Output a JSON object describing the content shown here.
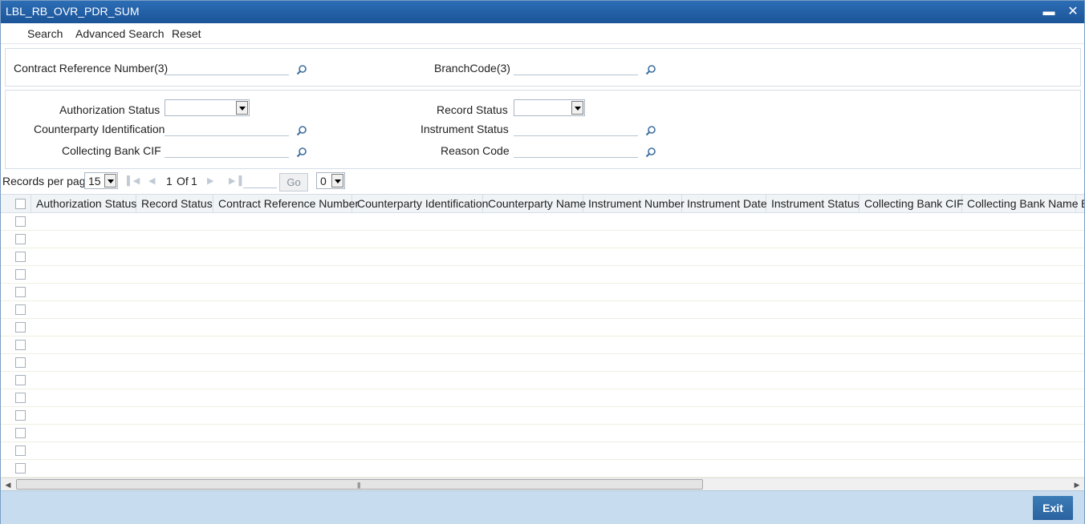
{
  "window": {
    "title": "LBL_RB_OVR_PDR_SUM",
    "minimize_icon": "minimize-icon",
    "close_icon": "close-icon"
  },
  "menu": {
    "search": "Search",
    "advanced_search": "Advanced Search",
    "reset": "Reset"
  },
  "search_panel": {
    "contract_ref_label": "Contract Reference Number(3)",
    "contract_ref_value": "",
    "branch_code_label": "BranchCode(3)",
    "branch_code_value": ""
  },
  "filters": {
    "authorization_status_label": "Authorization Status",
    "authorization_status_value": "",
    "record_status_label": "Record Status",
    "record_status_value": "",
    "counterparty_id_label": "Counterparty Identification",
    "counterparty_id_value": "",
    "instrument_status_label": "Instrument Status",
    "instrument_status_value": "",
    "collecting_bank_cif_label": "Collecting Bank CIF",
    "collecting_bank_cif_value": "",
    "reason_code_label": "Reason Code",
    "reason_code_value": ""
  },
  "pager": {
    "records_per_page_label": "Records per page",
    "records_per_page_value": "15",
    "current_page": "1",
    "of_label": "Of",
    "total_pages": "1",
    "go_label": "Go",
    "goto_select_value": "0"
  },
  "grid": {
    "columns": [
      "Authorization Status",
      "Record Status",
      "Contract Reference Number",
      "Counterparty Identification",
      "Counterparty Name",
      "Instrument Number",
      "Instrument Date",
      "Instrument Status",
      "Collecting Bank CIF",
      "Collecting Bank Name",
      "B"
    ],
    "row_count": 15
  },
  "footer": {
    "exit_label": "Exit"
  },
  "colors": {
    "title_bar": "#1f5ea8",
    "footer": "#c7dcee",
    "exit_button": "#2f6ea8"
  }
}
